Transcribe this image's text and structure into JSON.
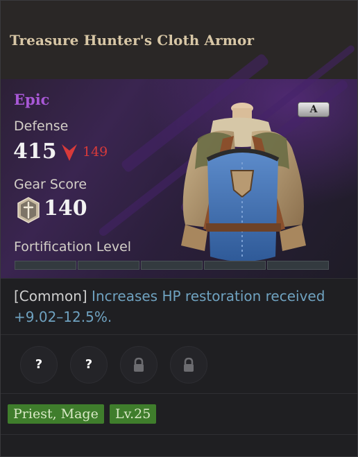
{
  "item": {
    "name": "Treasure Hunter's Cloth Armor",
    "rarity": "Epic",
    "grade": "A",
    "defense_label": "Defense",
    "defense_value": "415",
    "defense_diff": "149",
    "gear_score_label": "Gear Score",
    "gear_score_value": "140",
    "fortification_label": "Fortification Level",
    "fortification_level": 0,
    "fortification_max": 5
  },
  "effect": {
    "tag": "[Common]",
    "text": "Increases HP restoration received +9.02–12.5%."
  },
  "slots": [
    {
      "state": "unknown",
      "symbol": "?"
    },
    {
      "state": "unknown",
      "symbol": "?"
    },
    {
      "state": "locked",
      "icon": "lock-icon"
    },
    {
      "state": "locked",
      "icon": "lock-icon"
    }
  ],
  "tags": {
    "classes": "Priest, Mage",
    "level": "Lv.25"
  },
  "colors": {
    "rarity": "#a858d6",
    "decrease": "#d83a3a",
    "effect": "#6fa2c0",
    "tag_bg": "#3f7d2c"
  }
}
